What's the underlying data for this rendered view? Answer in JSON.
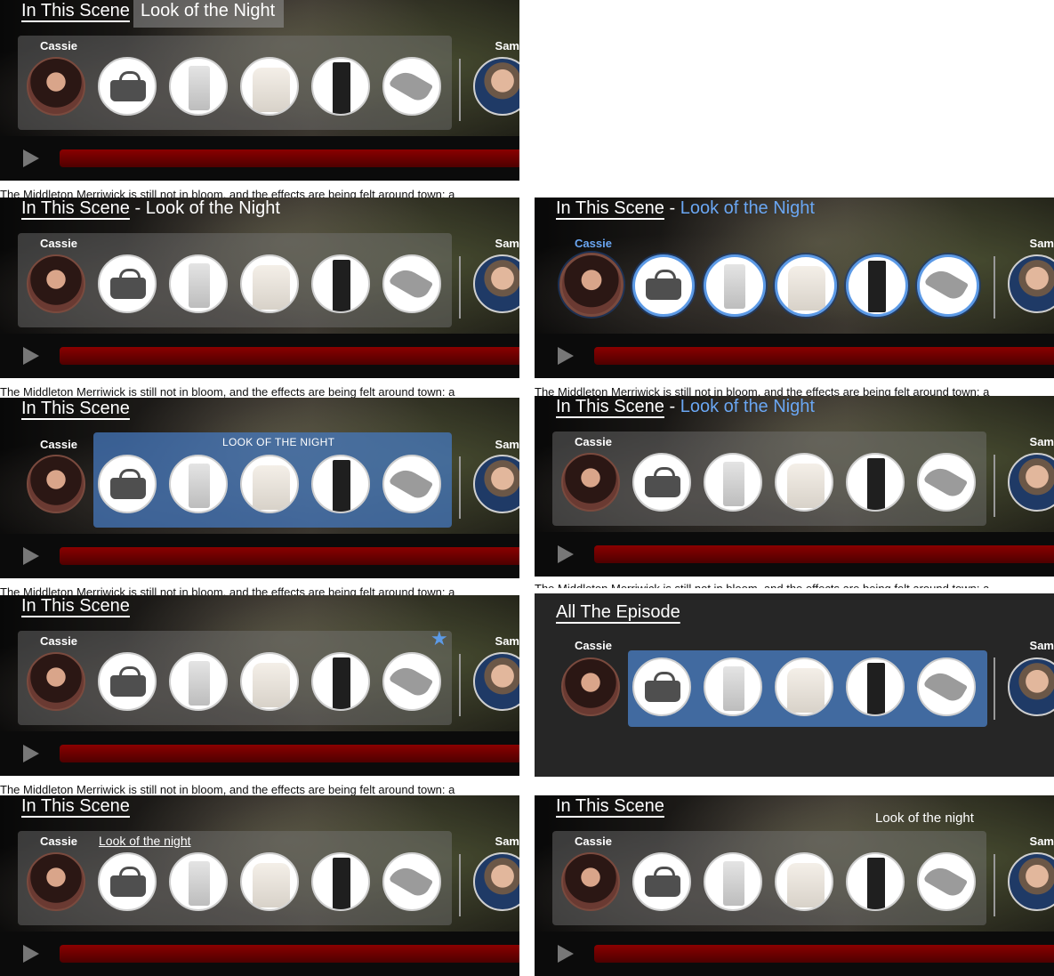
{
  "labels": {
    "in_this_scene": "In This Scene",
    "look_of_the_night": "Look of the Night",
    "look_of_the_night_upper": "LOOK OF THE NIGHT",
    "look_of_the_night_lower": "Look of the night",
    "all_the_episode": "All The Episode",
    "separator": " - ",
    "cassie": "Cassie",
    "sam": "Sam"
  },
  "caption_text": "The Middleton Merriwick is still not in bloom, and the effects are being felt around town: a",
  "icons": {
    "play": "play-icon",
    "star": "star-icon"
  },
  "colors": {
    "accent_blue": "#6aa6f2",
    "progress_red": "#8a0000"
  }
}
